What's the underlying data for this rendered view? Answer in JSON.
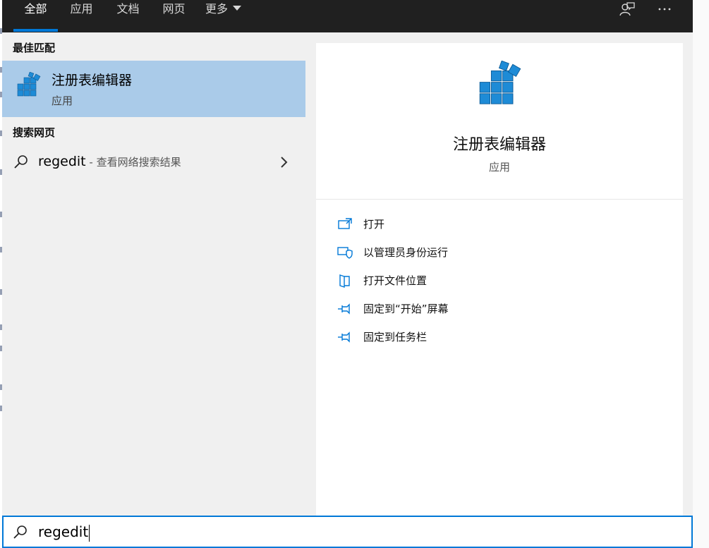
{
  "tabs": [
    {
      "label": "全部"
    },
    {
      "label": "应用"
    },
    {
      "label": "文档"
    },
    {
      "label": "网页"
    },
    {
      "label": "更多"
    }
  ],
  "best_match": {
    "section_title": "最佳匹配",
    "name": "注册表编辑器",
    "type": "应用"
  },
  "web": {
    "section_title": "搜索网页",
    "query": "regedit",
    "hint": " - 查看网络搜索结果"
  },
  "detail": {
    "title": "注册表编辑器",
    "subtitle": "应用",
    "actions": [
      {
        "label": "打开",
        "icon": "open-icon"
      },
      {
        "label": "以管理员身份运行",
        "icon": "shield-icon"
      },
      {
        "label": "打开文件位置",
        "icon": "file-location-icon"
      },
      {
        "label": "固定到“开始”屏幕",
        "icon": "pin-icon"
      },
      {
        "label": "固定到任务栏",
        "icon": "pin-icon"
      }
    ]
  },
  "search": {
    "value": "regedit"
  },
  "colors": {
    "accent": "#0078d7",
    "selected": "#aacbe9",
    "topbar": "#202020"
  }
}
